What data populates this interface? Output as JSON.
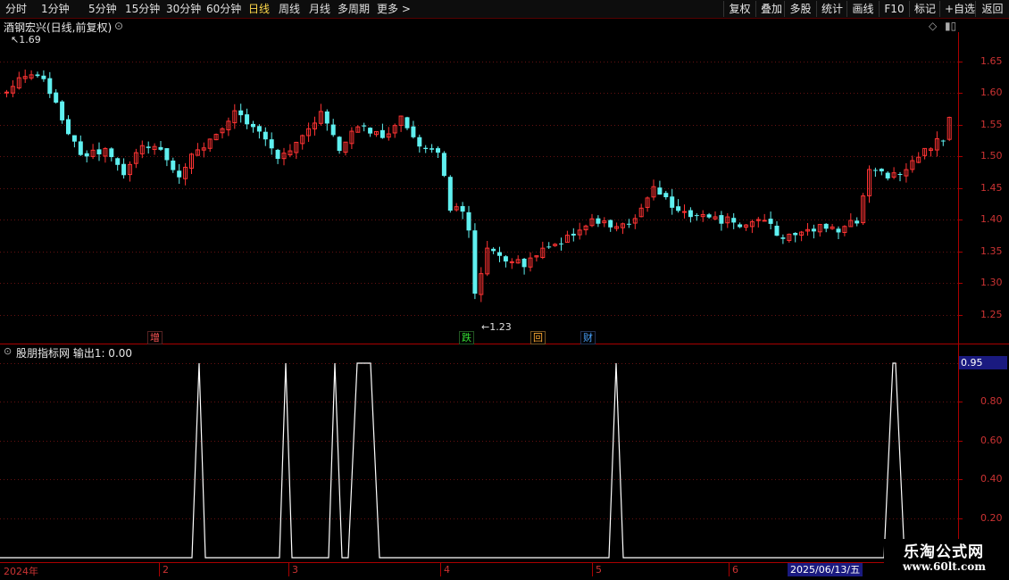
{
  "toolbar": {
    "periods": [
      "分时",
      "1分钟",
      "5分钟",
      "15分钟",
      "30分钟",
      "60分钟",
      "日线",
      "周线",
      "月线",
      "多周期",
      "更多 >"
    ],
    "active_period": "日线",
    "right_buttons": [
      "复权",
      "叠加",
      "多股",
      "统计",
      "画线",
      "F10",
      "标记",
      "+自选",
      "返回"
    ]
  },
  "main_chart": {
    "stock_title": "酒钢宏兴(日线,前复权)",
    "high_label": "1.69",
    "low_label": "1.23",
    "price_axis": [
      "1.65",
      "1.60",
      "1.55",
      "1.50",
      "1.45",
      "1.40",
      "1.35",
      "1.30",
      "1.25"
    ],
    "badges": [
      {
        "text": "增",
        "color": "#ff5555"
      },
      {
        "text": "跌",
        "color": "#33dd33"
      },
      {
        "text": "回",
        "color": "#ffaa33"
      },
      {
        "text": "财",
        "color": "#4aa3ff"
      }
    ],
    "colors": {
      "up": "#ff3333",
      "down": "#5ff0f0",
      "grid": "#661111"
    }
  },
  "indicator": {
    "title": "股朋指标网  输出1: 0.00",
    "current_value": "0.95",
    "axis": [
      "0.80",
      "0.60",
      "0.40",
      "0.20"
    ]
  },
  "time_axis": {
    "labels": [
      "2024年",
      "2",
      "3",
      "4",
      "5",
      "6"
    ],
    "current_date": "2025/06/13/五"
  },
  "watermark": {
    "line1": "乐淘公式网",
    "line2": "www.60lt.com"
  }
}
